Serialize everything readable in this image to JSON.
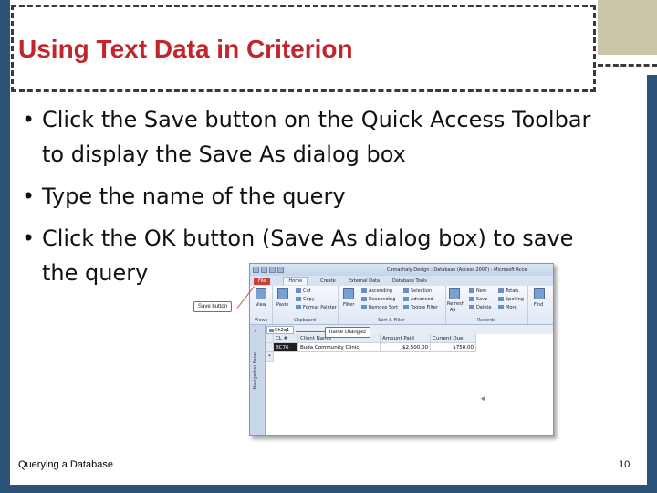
{
  "slide": {
    "title": "Using Text Data in Criterion",
    "bullets": [
      {
        "line1": "Click the Save button on the Quick Access Toolbar",
        "line2": "to display the Save As dialog box"
      },
      {
        "line1": "Type the name of the query",
        "line2": ""
      },
      {
        "line1": "Click the OK button (Save As dialog box) to save",
        "line2": "the query"
      }
    ],
    "footer_left": "Querying a Database",
    "page_number": "10",
    "colors": {
      "title": "#c0262c",
      "frame": "#2b5377",
      "accent_tan": "#c9c5a6"
    }
  },
  "screenshot": {
    "app_title": "Camashaly Design : Database (Access 2007) - Microsoft Acce",
    "tabs": [
      "File",
      "Home",
      "Create",
      "External Data",
      "Database Tools"
    ],
    "ribbon": {
      "view": {
        "label": "View",
        "group": "Views"
      },
      "clipboard": {
        "paste": "Paste",
        "cut": "Cut",
        "copy": "Copy",
        "format_painter": "Format Painter",
        "group": "Clipboard"
      },
      "sort_filter": {
        "filter": "Filter",
        "ascending": "Ascending",
        "descending": "Descending",
        "remove_sort": "Remove Sort",
        "selection": "Selection",
        "advanced": "Advanced",
        "toggle_filter": "Toggle Filter",
        "group": "Sort & Filter"
      },
      "records": {
        "refresh": "Refresh",
        "refresh_all": "All",
        "new": "New",
        "save": "Save",
        "delete": "Delete",
        "totals": "Totals",
        "spelling": "Spelling",
        "more": "More",
        "group": "Records"
      },
      "find": {
        "label": "Find"
      }
    },
    "nav_pane_label": "Navigation Pane",
    "query_tab": "Ch2q1",
    "columns": [
      "CL #",
      "Client Name",
      "Amount Paid",
      "Current Due"
    ],
    "rows": [
      {
        "cl": "BC76",
        "name": "Buda Community Clinic",
        "paid": "$2,500.00",
        "due": "$750.00"
      }
    ],
    "new_row_marker": "*"
  },
  "callouts": {
    "save_button": "Save button",
    "name_changed": "name changed"
  }
}
